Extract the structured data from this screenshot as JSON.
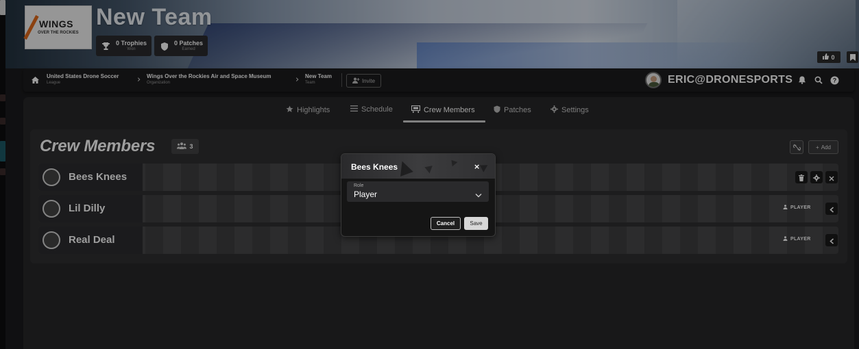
{
  "brand": {
    "logo_line1": "WINGS",
    "logo_line2": "OVER THE ROCKIES",
    "accent": "#e06a1b"
  },
  "team": {
    "name": "New Team",
    "trophies": {
      "label": "0 Trophies",
      "sub": "Won",
      "icon": "trophy-icon"
    },
    "patches": {
      "label": "0 Patches",
      "sub": "Earned",
      "icon": "shield-icon"
    },
    "likes": "0"
  },
  "breadcrumb": {
    "home_icon": "home-icon",
    "items": [
      {
        "title": "United States Drone Soccer",
        "sub": "League"
      },
      {
        "title": "Wings Over the Rockies Air and Space Museum",
        "sub": "Organization"
      },
      {
        "title": "New Team",
        "sub": "Team"
      }
    ],
    "invite_label": "Invite"
  },
  "user": {
    "name": "ERIC@DRONESPORTS"
  },
  "tabs": [
    {
      "label": "Highlights",
      "icon": "star-icon"
    },
    {
      "label": "Schedule",
      "icon": "list-icon"
    },
    {
      "label": "Crew Members",
      "icon": "crew-icon",
      "active": true
    },
    {
      "label": "Patches",
      "icon": "shield-icon"
    },
    {
      "label": "Settings",
      "icon": "gear-icon"
    }
  ],
  "crew": {
    "title": "Crew Members",
    "count": "3",
    "add_label": "Add",
    "members": [
      {
        "name": "Bees Knees",
        "role": ""
      },
      {
        "name": "Lil Dilly",
        "role": "PLAYER"
      },
      {
        "name": "Real Deal",
        "role": "PLAYER"
      }
    ]
  },
  "modal": {
    "title": "Bees Knees",
    "close": "×",
    "role_label": "Role",
    "role_value": "Player",
    "cancel": "Cancel",
    "save": "Save"
  }
}
